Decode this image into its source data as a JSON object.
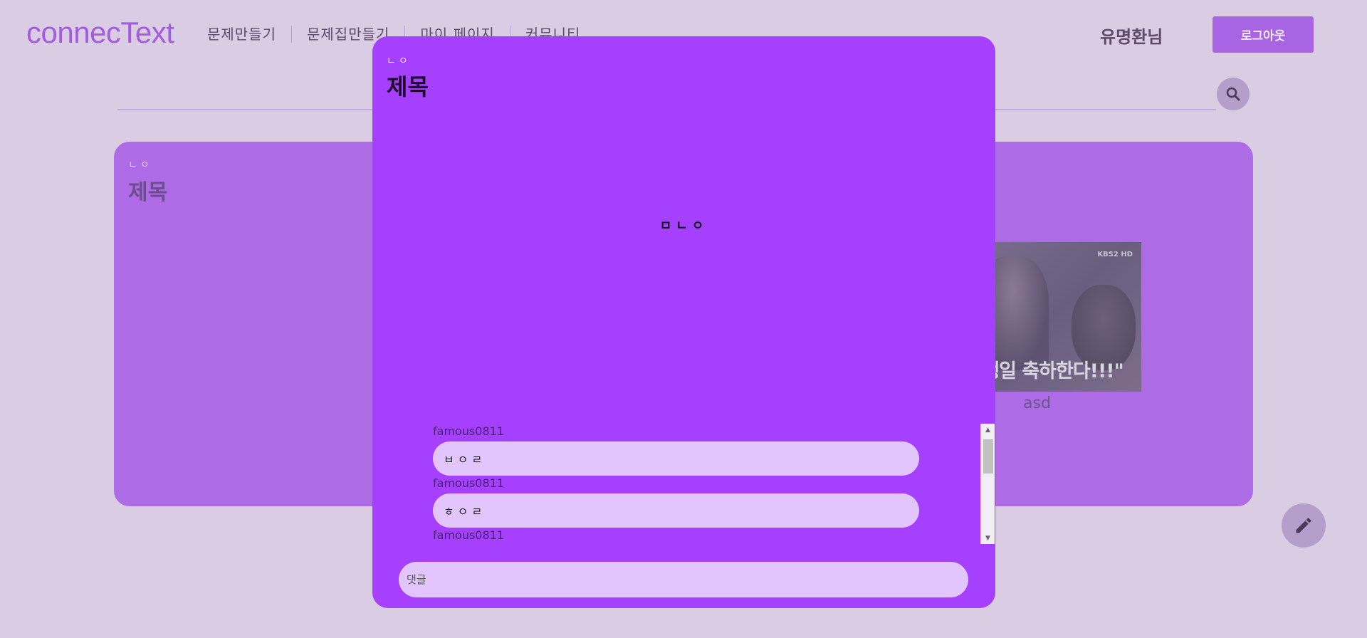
{
  "header": {
    "logo": "connecText",
    "nav": [
      {
        "label": "문제만들기"
      },
      {
        "label": "문제집만들기"
      },
      {
        "label": "마이 페이지"
      },
      {
        "label": "커뮤니티"
      }
    ],
    "username": "유명환님",
    "logout_label": "로그아웃"
  },
  "search": {
    "icon": "search-icon"
  },
  "background_card": {
    "subtitle": "ㄴㅇ",
    "title": "제목",
    "image": {
      "channel": "KBS2 HD",
      "caption": "가 생일 축하한다!!!\""
    },
    "image_label": "asd"
  },
  "edit_button": {
    "icon": "pencil-icon"
  },
  "modal": {
    "subtitle": "ㄴㅇ",
    "title": "제목",
    "body": "ㅁㄴㅇ",
    "comments": [
      {
        "user": "famous0811",
        "text": "ㅂㅇㄹ"
      },
      {
        "user": "famous0811",
        "text": "ㅎㅇㄹ"
      },
      {
        "user": "famous0811",
        "text": ""
      }
    ],
    "comment_placeholder": "댓글"
  },
  "colors": {
    "background": "#d9cce3",
    "brand": "#a25ce0",
    "modal": "#a640ff",
    "card": "#ad6be6",
    "bubble": "#e2c5fd"
  }
}
